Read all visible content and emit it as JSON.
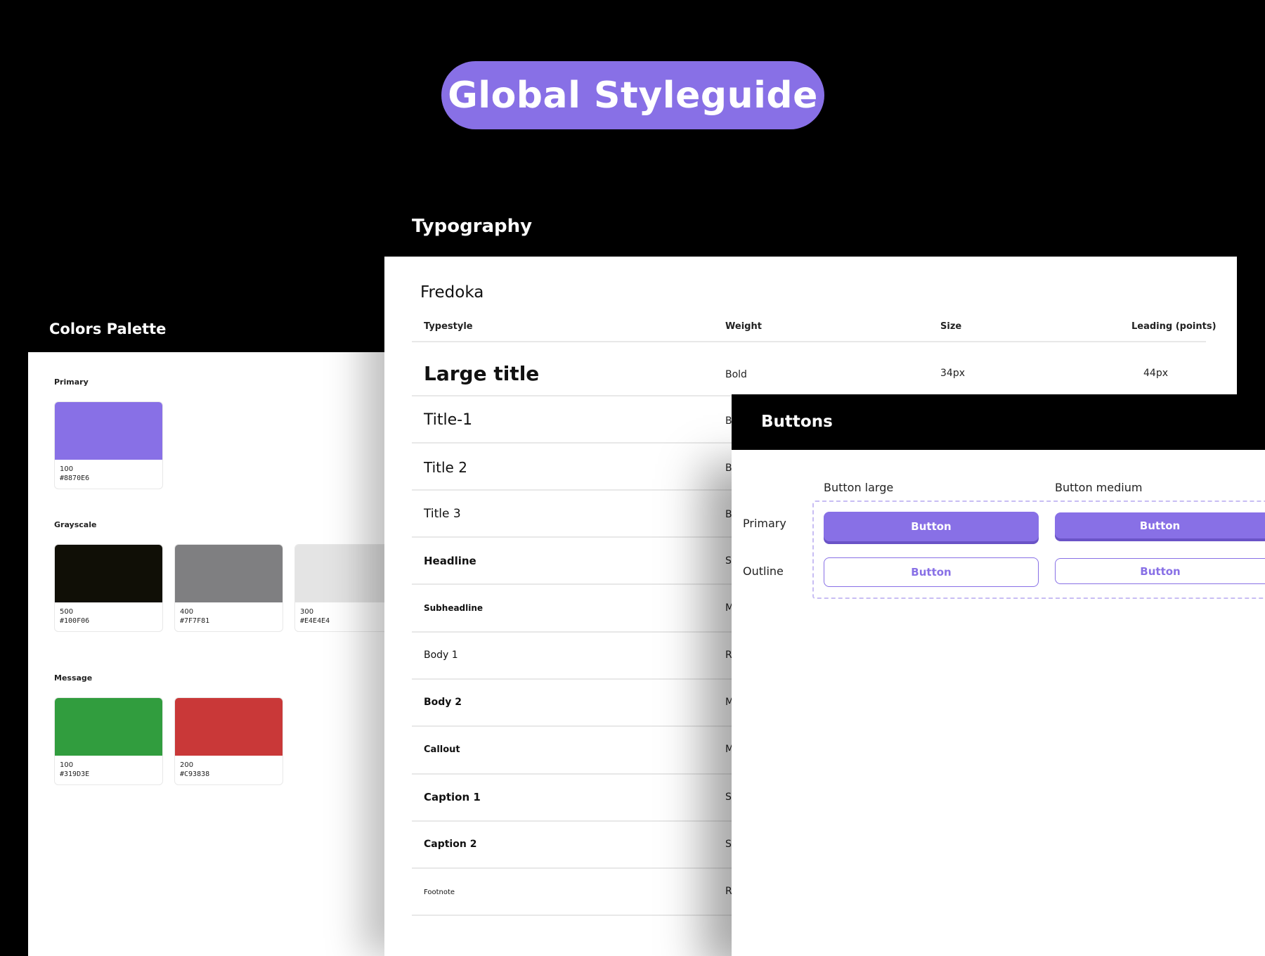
{
  "page_title": "Global Styleguide",
  "colors": {
    "heading": "Colors Palette",
    "groups": [
      {
        "label": "Primary",
        "swatches": [
          {
            "step": "100",
            "hex": "#8870E6"
          }
        ]
      },
      {
        "label": "Grayscale",
        "swatches": [
          {
            "step": "500",
            "hex": "#100F06"
          },
          {
            "step": "400",
            "hex": "#7F7F81"
          },
          {
            "step": "300",
            "hex": "#E4E4E4"
          }
        ]
      },
      {
        "label": "Message",
        "swatches": [
          {
            "step": "100",
            "hex": "#319D3E"
          },
          {
            "step": "200",
            "hex": "#C93838"
          }
        ]
      }
    ]
  },
  "typography": {
    "heading": "Typography",
    "font_name": "Fredoka",
    "columns": [
      "Typestyle",
      "Weight",
      "Size",
      "Leading (points)"
    ],
    "rows": [
      {
        "name": "Large title",
        "weight": "Bold",
        "size": "34px",
        "leading": "44px"
      },
      {
        "name": "Title-1",
        "weight": "B"
      },
      {
        "name": "Title 2",
        "weight": "B"
      },
      {
        "name": "Title 3",
        "weight": "B"
      },
      {
        "name": "Headline",
        "weight": "S"
      },
      {
        "name": "Subheadline",
        "weight": "M"
      },
      {
        "name": "Body 1",
        "weight": "R"
      },
      {
        "name": "Body 2",
        "weight": "M"
      },
      {
        "name": "Callout",
        "weight": "M"
      },
      {
        "name": "Caption 1",
        "weight": "S"
      },
      {
        "name": "Caption 2",
        "weight": "S"
      },
      {
        "name": "Footnote",
        "weight": "R"
      }
    ]
  },
  "buttons": {
    "heading": "Buttons",
    "columns": [
      "Button large",
      "Button medium"
    ],
    "rows": [
      "Primary",
      "Outline"
    ],
    "button_label": "Button",
    "accent": "#8870E6"
  }
}
